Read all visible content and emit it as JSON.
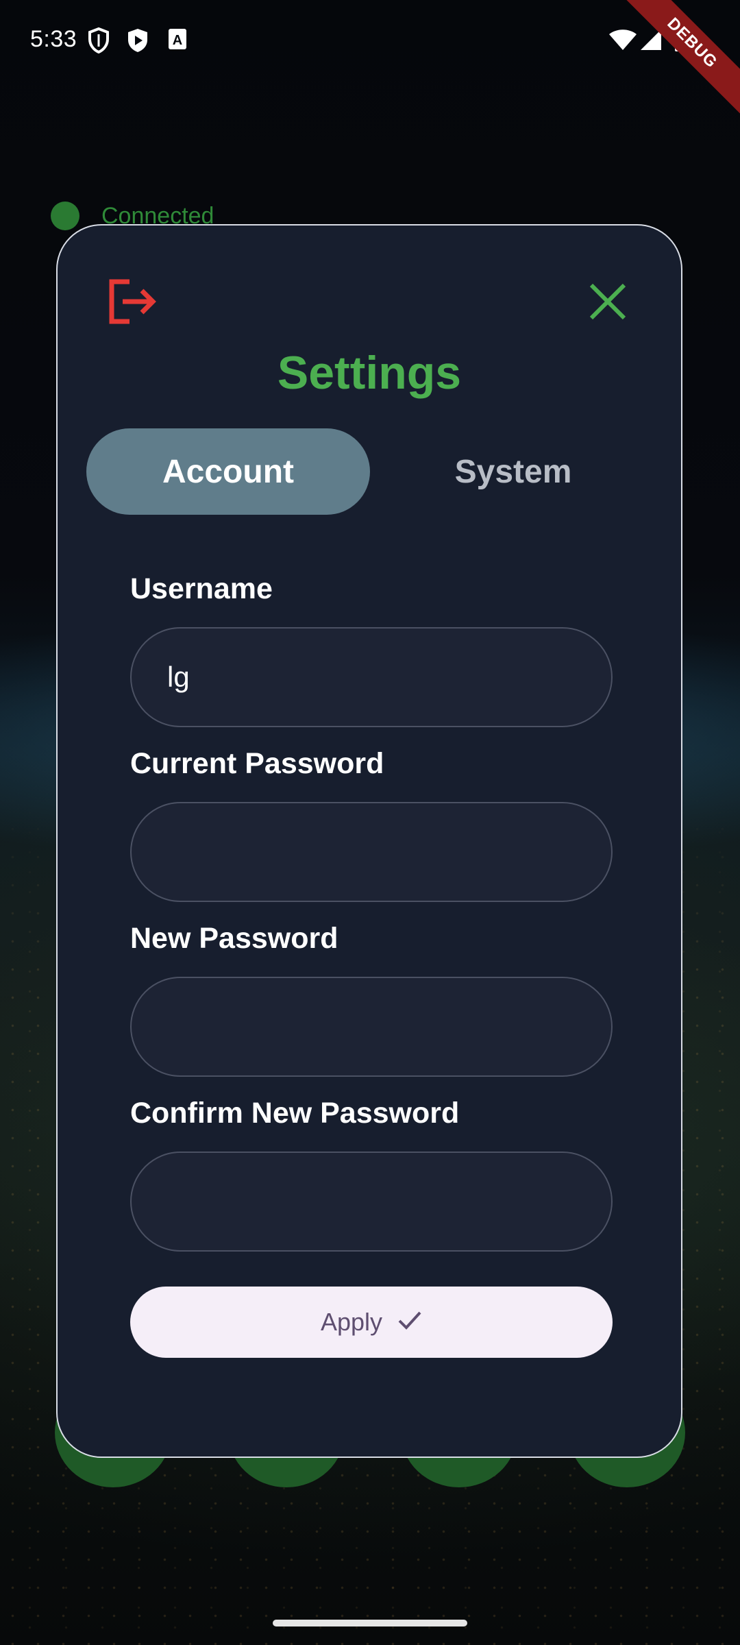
{
  "status_bar": {
    "time": "5:33",
    "debug_banner": "DEBUG",
    "icons": [
      "shield-icon",
      "play-store-icon",
      "font-a-icon",
      "wifi-icon",
      "signal-icon",
      "battery-icon"
    ]
  },
  "background": {
    "connection_status": "Connected",
    "connection_color": "#2f8a38"
  },
  "dialog": {
    "title": "Settings",
    "title_color": "#4caf50",
    "logout_icon": "logout-icon",
    "logout_color": "#e53935",
    "close_icon": "close-icon",
    "close_color": "#4caf50",
    "tabs": [
      {
        "label": "Account",
        "selected": true
      },
      {
        "label": "System",
        "selected": false
      }
    ],
    "fields": {
      "username": {
        "label": "Username",
        "value": "lg"
      },
      "current_password": {
        "label": "Current Password",
        "value": ""
      },
      "new_password": {
        "label": "New Password",
        "value": ""
      },
      "confirm_password": {
        "label": "Confirm New Password",
        "value": ""
      }
    },
    "apply_button": {
      "label": "Apply",
      "icon": "check-icon"
    }
  },
  "colors": {
    "dialog_bg": "#171e2e",
    "tab_selected_bg": "#607d8b",
    "apply_bg": "#f5eef8"
  }
}
